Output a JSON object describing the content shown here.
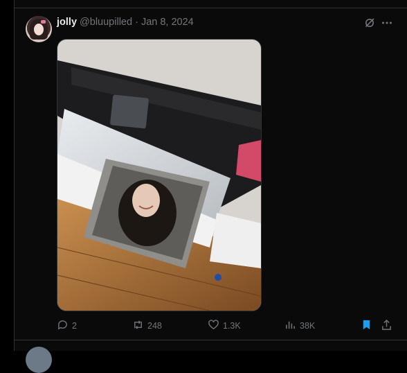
{
  "tweet": {
    "display_name": "jolly",
    "handle": "@bluupilled",
    "separator": "·",
    "date": "Jan 8, 2024",
    "stats": {
      "replies": "2",
      "reposts": "248",
      "likes": "1.3K",
      "views": "38K"
    }
  },
  "icons": {
    "grok": "grok-icon",
    "more": "more-icon",
    "reply": "reply-icon",
    "repost": "repost-icon",
    "like": "heart-icon",
    "views": "views-icon",
    "bookmark": "bookmark-icon",
    "share": "share-icon"
  },
  "colors": {
    "background": "#0a0a0a",
    "muted": "#71767b",
    "text": "#e7e9ea",
    "bookmark_active": "#1d9bf0",
    "divider": "#2f3336"
  }
}
